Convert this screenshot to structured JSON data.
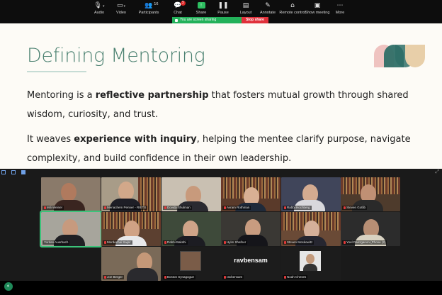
{
  "toolbar": {
    "items": [
      {
        "label": "Audio",
        "icon": "microphone-icon"
      },
      {
        "label": "Video",
        "icon": "video-camera-icon"
      },
      {
        "label": "Participants",
        "icon": "participants-icon",
        "count": "16"
      },
      {
        "label": "Chat",
        "icon": "chat-icon",
        "badge": "3"
      },
      {
        "label": "Share",
        "icon": "share-screen-icon"
      },
      {
        "label": "Pause",
        "icon": "pause-icon"
      },
      {
        "label": "Layout",
        "icon": "layout-icon"
      },
      {
        "label": "Annotate",
        "icon": "annotate-pen-icon"
      },
      {
        "label": "Remote control",
        "icon": "remote-control-icon"
      },
      {
        "label": "Show meeting",
        "icon": "show-meeting-icon"
      },
      {
        "label": "More",
        "icon": "more-icon"
      }
    ],
    "share_status": "You are screen sharing",
    "stop_share": "Stop share"
  },
  "slide": {
    "title": "Defining Mentoring",
    "p1_a": "Mentoring is a ",
    "p1_b": "reflective partnership",
    "p1_c": " that fosters mutual growth through shared wisdom, curiosity, and trust.",
    "p2_a": "It weaves ",
    "p2_b": "experience with inquiry",
    "p2_c": ", helping the mentee clarify purpose, navigate complexity, and build confidence in their own leadership."
  },
  "colors": {
    "slide_title": "#4a8070",
    "logo_pink": "#efc3c0",
    "logo_teal": "#2f6f67",
    "logo_sand": "#e8cfa9",
    "share_green": "#23b15a",
    "stop_red": "#e0313b",
    "active_speaker": "#3cc37a"
  },
  "participants": [
    {
      "name": "Mili Weiner"
    },
    {
      "name": "Menachem Penner - RIETS"
    },
    {
      "name": "Dovidy Shulman"
    },
    {
      "name": "Avram Rothman"
    },
    {
      "name": "Rabbi Hochberg"
    },
    {
      "name": "Steven Gotlib"
    },
    {
      "name": "Yordan Auerbach"
    },
    {
      "name": "Mordechai Swjer"
    },
    {
      "name": "Rabbi Bakshi"
    },
    {
      "name": "Hyim Shafner"
    },
    {
      "name": "Steven Moskowitz"
    },
    {
      "name": "Yoel Danzganon (Phone (2)"
    },
    {
      "name": "Joe Berger"
    },
    {
      "name": "Boston Synagogue"
    },
    {
      "name": "ravbensam"
    },
    {
      "name": "Noah Cheses"
    }
  ],
  "ravbensam_label": "ravbensam"
}
